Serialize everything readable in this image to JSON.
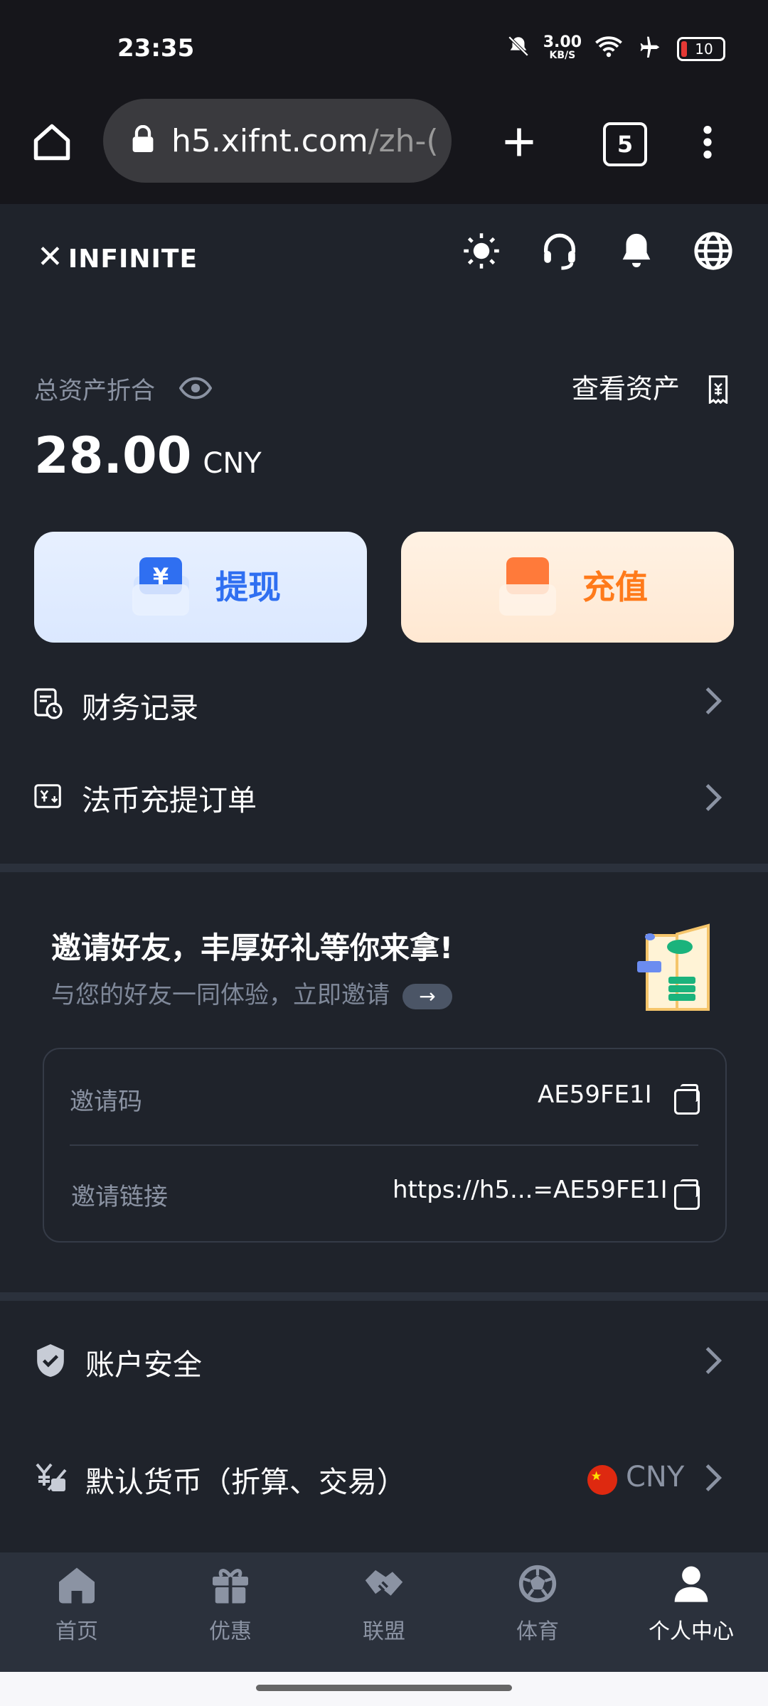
{
  "status_bar": {
    "time": "23:35",
    "net_speed_top": "3.00",
    "net_speed_unit": "KB/S",
    "battery": "10",
    "icons": [
      "silent-bell-icon",
      "wifi-icon",
      "airplane-icon",
      "battery-icon"
    ]
  },
  "browser": {
    "url_host": "h5.xifnt.com",
    "url_path": "/zh-(",
    "tab_count": "5"
  },
  "header": {
    "logo_text": "INFINITE",
    "icons": [
      "sun-icon",
      "headset-icon",
      "bell-icon",
      "globe-icon"
    ]
  },
  "assets": {
    "label": "总资产折合",
    "view_assets": "查看资产",
    "amount": "28.00",
    "currency": "CNY"
  },
  "actions": {
    "withdraw": "提现",
    "deposit": "充值"
  },
  "menu1": [
    {
      "label": "财务记录"
    },
    {
      "label": "法币充提订单"
    }
  ],
  "invite": {
    "title": "邀请好友，丰厚好礼等你来拿!",
    "subtitle": "与您的好友一同体验，立即邀请",
    "code_label": "邀请码",
    "code_value": "AE59FE1I",
    "link_label": "邀请链接",
    "link_value": "https://h5...=AE59FE1I"
  },
  "menu2": {
    "security": "账户安全",
    "currency_label": "默认货币（折算、交易）",
    "currency_value": "CNY"
  },
  "bottom_nav": [
    {
      "label": "首页",
      "icon": "home-icon"
    },
    {
      "label": "优惠",
      "icon": "gift-icon"
    },
    {
      "label": "联盟",
      "icon": "handshake-icon"
    },
    {
      "label": "体育",
      "icon": "soccer-ball-icon"
    },
    {
      "label": "个人中心",
      "icon": "user-icon",
      "active": true
    }
  ],
  "colors": {
    "bg": "#1f232b",
    "accent_blue": "#2f6ff1",
    "accent_orange": "#ff7a1a",
    "muted": "#8b93a3"
  }
}
